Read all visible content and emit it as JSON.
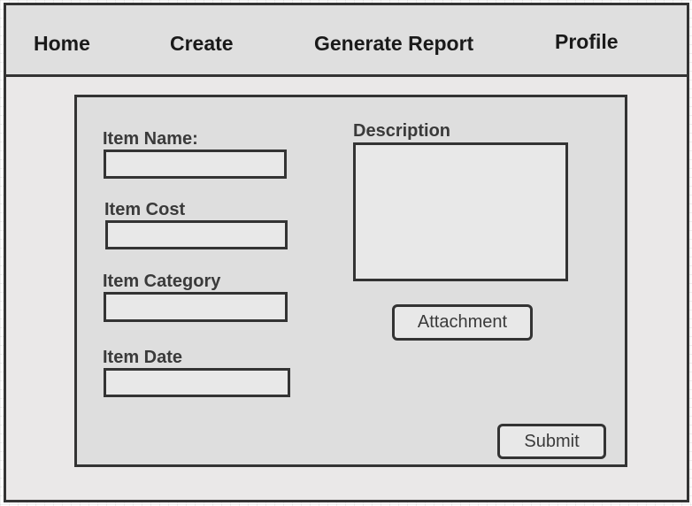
{
  "nav": {
    "home": "Home",
    "create": "Create",
    "generate_report": "Generate Report",
    "profile": "Profile"
  },
  "form": {
    "item_name_label": "Item Name:",
    "item_name_value": "",
    "item_cost_label": "Item Cost",
    "item_cost_value": "",
    "item_category_label": "Item Category",
    "item_category_value": "",
    "item_date_label": "Item Date",
    "item_date_value": "",
    "description_label": "Description",
    "description_value": "",
    "attachment_button": "Attachment",
    "submit_button": "Submit"
  },
  "colors": {
    "border": "#333333",
    "navbar_bg": "#dfdfdf",
    "window_bg": "#eae8e8",
    "panel_bg": "#dedede",
    "field_bg": "#e8e8e8"
  }
}
